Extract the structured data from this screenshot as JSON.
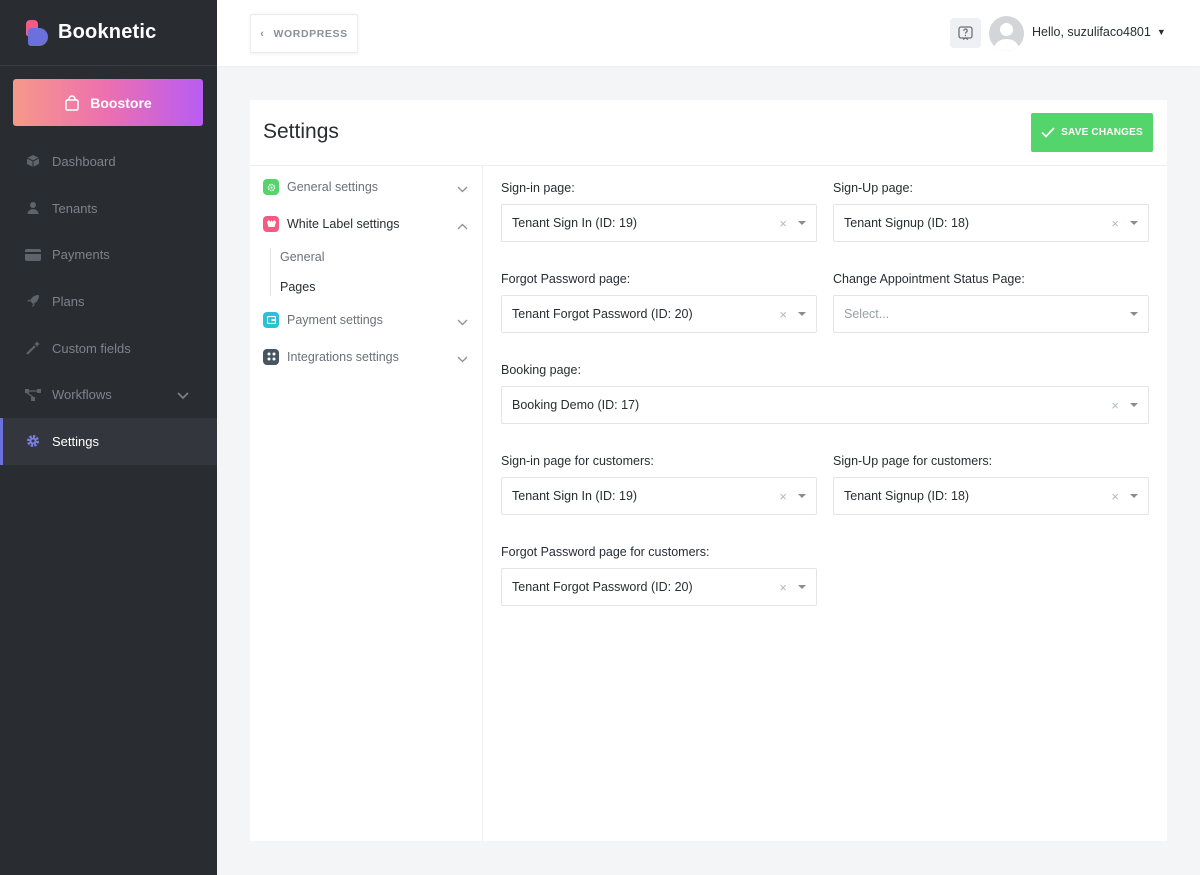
{
  "app": {
    "name": "Booknetic"
  },
  "sidebar": {
    "boostore_label": "Boostore",
    "items": [
      {
        "label": "Dashboard",
        "icon": "cube-icon"
      },
      {
        "label": "Tenants",
        "icon": "user-icon"
      },
      {
        "label": "Payments",
        "icon": "credit-card-icon"
      },
      {
        "label": "Plans",
        "icon": "rocket-icon"
      },
      {
        "label": "Custom fields",
        "icon": "magic-wand-icon"
      },
      {
        "label": "Workflows",
        "icon": "workflow-icon"
      },
      {
        "label": "Settings",
        "icon": "gear-icon"
      }
    ]
  },
  "header": {
    "back_label": "WORDPRESS",
    "user_greeting": "Hello, suzulifaco4801"
  },
  "page": {
    "title": "Settings",
    "save_label": "SAVE CHANGES"
  },
  "settings_nav": {
    "items": [
      {
        "label": "General settings",
        "color": "#53d56c"
      },
      {
        "label": "White Label settings",
        "color": "#f45a82"
      },
      {
        "label": "Payment settings",
        "color": "#2bc0d6"
      },
      {
        "label": "Integrations settings",
        "color": "#475462"
      }
    ],
    "sub_items": [
      "General",
      "Pages"
    ]
  },
  "form": {
    "signin": {
      "label": "Sign-in page:",
      "value": "Tenant Sign In (ID: 19)"
    },
    "signup": {
      "label": "Sign-Up page:",
      "value": "Tenant Signup (ID: 18)"
    },
    "forgot": {
      "label": "Forgot Password page:",
      "value": "Tenant Forgot Password (ID: 20)"
    },
    "change_status": {
      "label": "Change Appointment Status Page:",
      "placeholder": "Select..."
    },
    "booking": {
      "label": "Booking page:",
      "value": "Booking Demo (ID: 17)"
    },
    "signin_customers": {
      "label": "Sign-in page for customers:",
      "value": "Tenant Sign In (ID: 19)"
    },
    "signup_customers": {
      "label": "Sign-Up page for customers:",
      "value": "Tenant Signup (ID: 18)"
    },
    "forgot_customers": {
      "label": "Forgot Password page for customers:",
      "value": "Tenant Forgot Password (ID: 20)"
    }
  },
  "colors": {
    "accent": "#6c70dc",
    "save": "#53d56c",
    "sidebar_bg": "#292d32"
  }
}
